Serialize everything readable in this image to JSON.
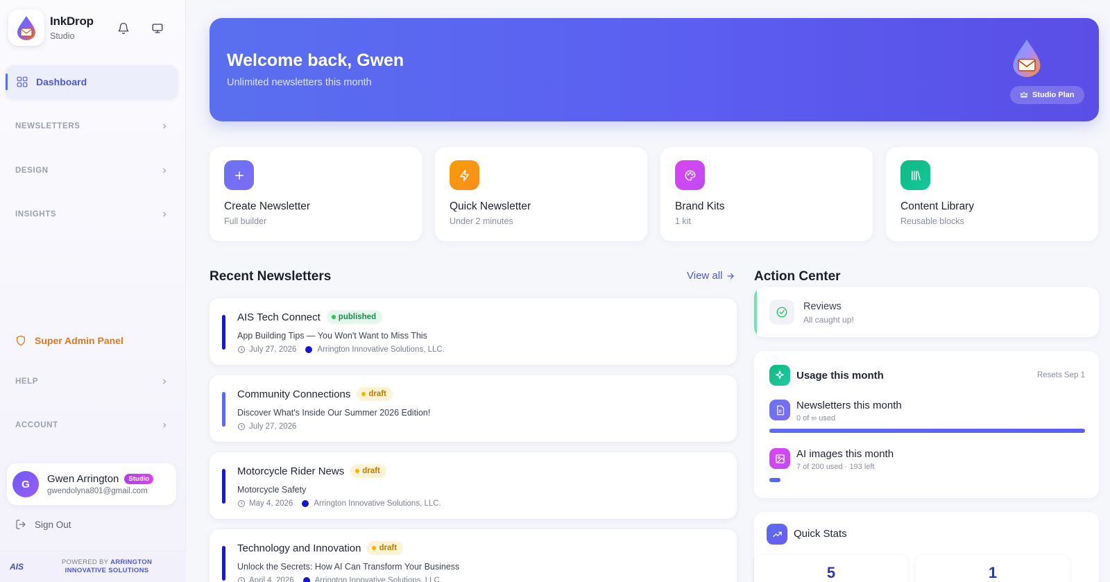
{
  "brand": {
    "name": "InkDrop",
    "sub": "Studio"
  },
  "sidebar": {
    "active": {
      "label": "Dashboard"
    },
    "sections": [
      {
        "label": "NEWSLETTERS"
      },
      {
        "label": "DESIGN"
      },
      {
        "label": "INSIGHTS"
      },
      {
        "label": "HELP"
      },
      {
        "label": "ACCOUNT"
      }
    ],
    "admin_label": "Super Admin Panel",
    "user": {
      "initial": "G",
      "name": "Gwen Arrington",
      "badge": "Studio",
      "email": "gwendolyna801@gmail.com"
    },
    "signout_label": "Sign Out",
    "powered_prefix": "POWERED BY",
    "powered_company": "ARRINGTON INNOVATIVE SOLUTIONS",
    "powered_logo": "AIS"
  },
  "hero": {
    "title": "Welcome back, Gwen",
    "subtitle": "Unlimited newsletters this month",
    "plan_label": "Studio Plan"
  },
  "quick_actions": [
    {
      "title": "Create Newsletter",
      "sub": "Full builder",
      "icon": "plus-icon",
      "color": "#6b72f2"
    },
    {
      "title": "Quick Newsletter",
      "sub": "Under 2 minutes",
      "icon": "lightning-icon",
      "color": "#f59e0b"
    },
    {
      "title": "Brand Kits",
      "sub": "1 kit",
      "icon": "palette-icon",
      "color": "#d946ef"
    },
    {
      "title": "Content Library",
      "sub": "Reusable blocks",
      "icon": "library-icon",
      "color": "#10b981"
    }
  ],
  "recent": {
    "title": "Recent Newsletters",
    "view_all": "View all",
    "items": [
      {
        "title": "AIS Tech Connect",
        "status": "published",
        "subtitle": "App Building Tips — You Won't Want to Miss This",
        "date": "July 27, 2026",
        "org": "Arrington Innovative Solutions, LLC.",
        "bar_color": "#1a1ac8"
      },
      {
        "title": "Community Connections",
        "status": "draft",
        "subtitle": "Discover What's Inside Our Summer 2026 Edition!",
        "date": "July 27, 2026",
        "org": "",
        "bar_color": "#5b6cf0"
      },
      {
        "title": "Motorcycle Rider News",
        "status": "draft",
        "subtitle": "Motorcycle Safety",
        "date": "May 4, 2026",
        "org": "Arrington Innovative Solutions, LLC.",
        "bar_color": "#1a1ac8"
      },
      {
        "title": "Technology and Innovation",
        "status": "draft",
        "subtitle": "Unlock the Secrets: How AI Can Transform Your Business",
        "date": "April 4, 2026",
        "org": "Arrington Innovative Solutions, LLC.",
        "bar_color": "#1a1ac8"
      }
    ]
  },
  "action_center": {
    "title": "Action Center",
    "reviews": {
      "title": "Reviews",
      "sub": "All caught up!"
    }
  },
  "usage": {
    "title": "Usage this month",
    "reset": "Resets Sep 1",
    "items": [
      {
        "title": "Newsletters this month",
        "sub": "0 of ∞ used",
        "fill": 1.0,
        "icon": "document-icon",
        "color": "#6b72f2"
      },
      {
        "title": "AI images this month",
        "sub": "7 of 200 used · 193 left",
        "fill": 0.035,
        "icon": "image-icon",
        "color": "#d946ef"
      }
    ]
  },
  "quick_stats": {
    "title": "Quick Stats",
    "values": [
      "5",
      "1"
    ]
  }
}
